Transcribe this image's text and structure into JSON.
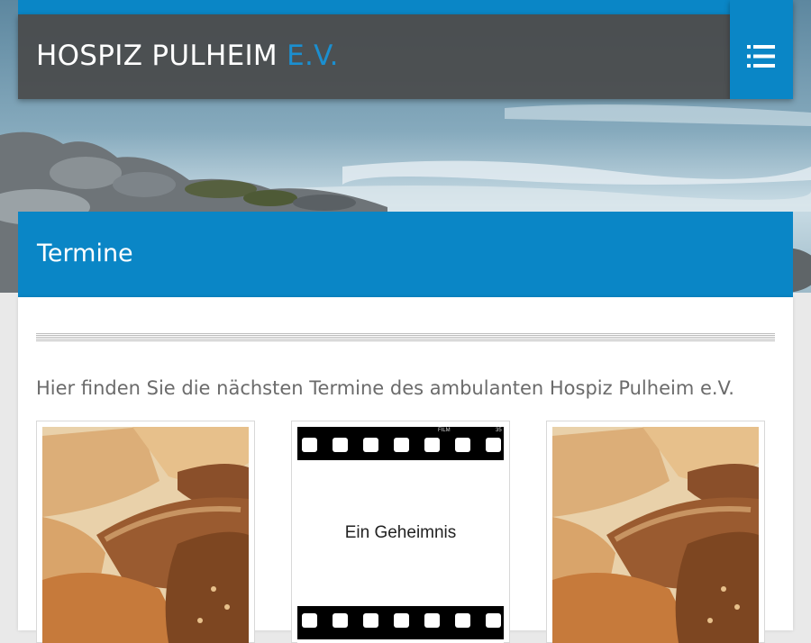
{
  "site": {
    "title_main": "HOSPIZ PULHEIM",
    "title_suffix": "E.V."
  },
  "menu": {
    "icon": "list-menu-icon"
  },
  "page": {
    "title": "Termine",
    "intro": "Hier finden Sie die nächsten Termine des ambulanten Hospiz Pulheim e.V."
  },
  "cards": [
    {
      "image": "bread-image"
    },
    {
      "image": "film-strip-image",
      "caption": "Ein Geheimnis",
      "film_label": "FILM",
      "film_number": "35"
    },
    {
      "image": "bread-image"
    }
  ],
  "colors": {
    "accent": "#0a86c6",
    "header_bg": "#484848",
    "intro_text": "#6b6b6b"
  }
}
